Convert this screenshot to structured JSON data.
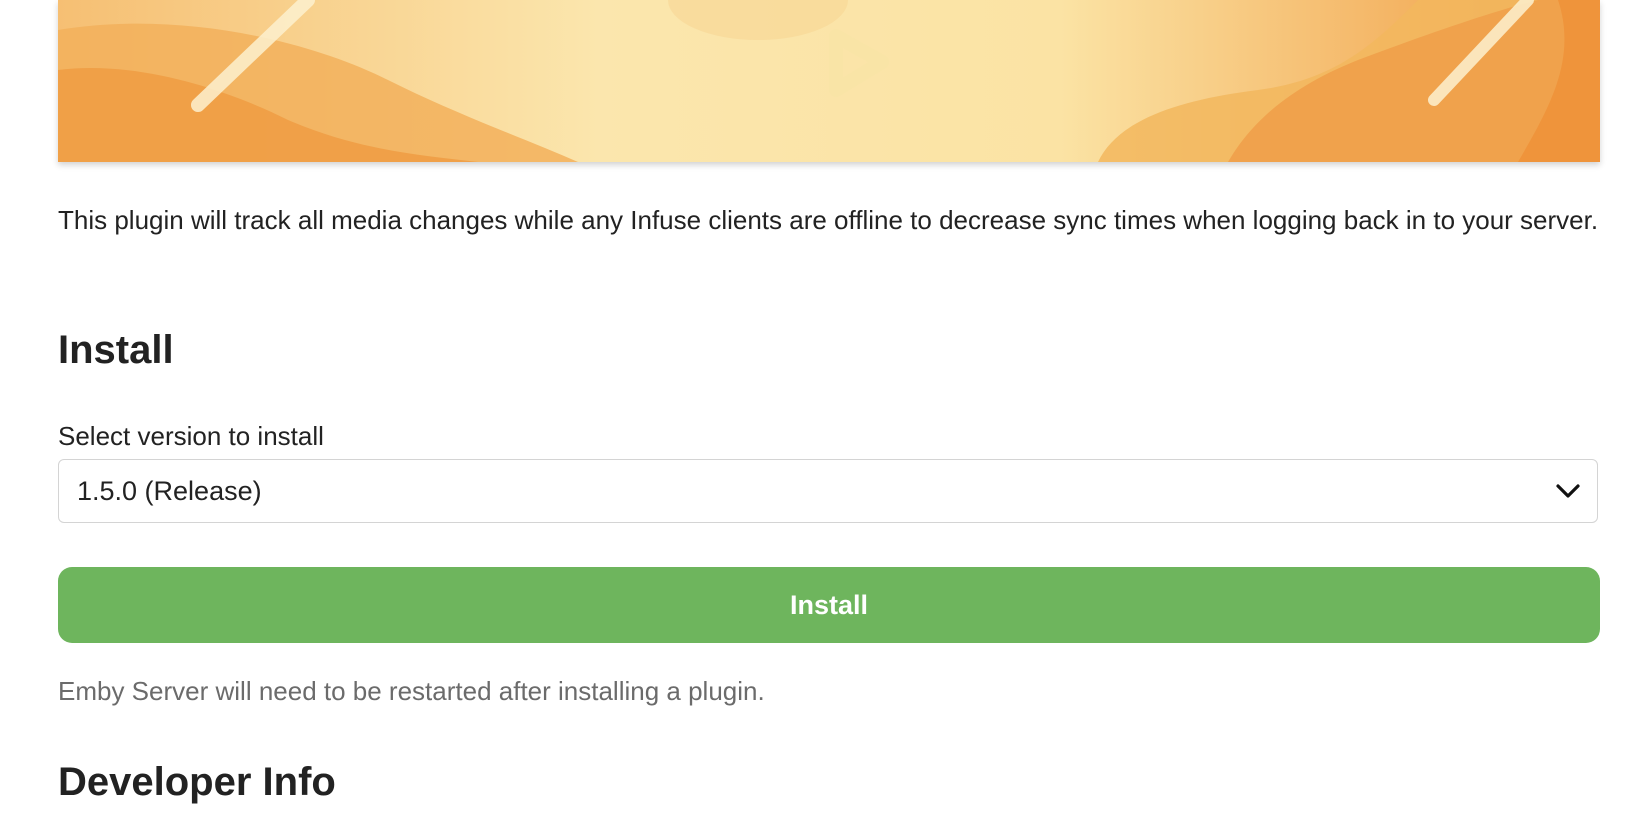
{
  "banner": {
    "icon": "play-icon",
    "colors": {
      "light": "#fbeab4",
      "mid": "#f5c57a",
      "dark": "#ef9740"
    }
  },
  "description": "This plugin will track all media changes while any Infuse clients are offline to decrease sync times when logging back in to your server.",
  "install_section": {
    "heading": "Install",
    "select_label": "Select version to install",
    "selected_version": "1.5.0 (Release)",
    "dropdown_icon": "chevron-down-icon",
    "install_button_label": "Install",
    "install_button_color": "#6eb55d",
    "restart_note": "Emby Server will need to be restarted after installing a plugin."
  },
  "developer_section": {
    "heading": "Developer Info"
  }
}
